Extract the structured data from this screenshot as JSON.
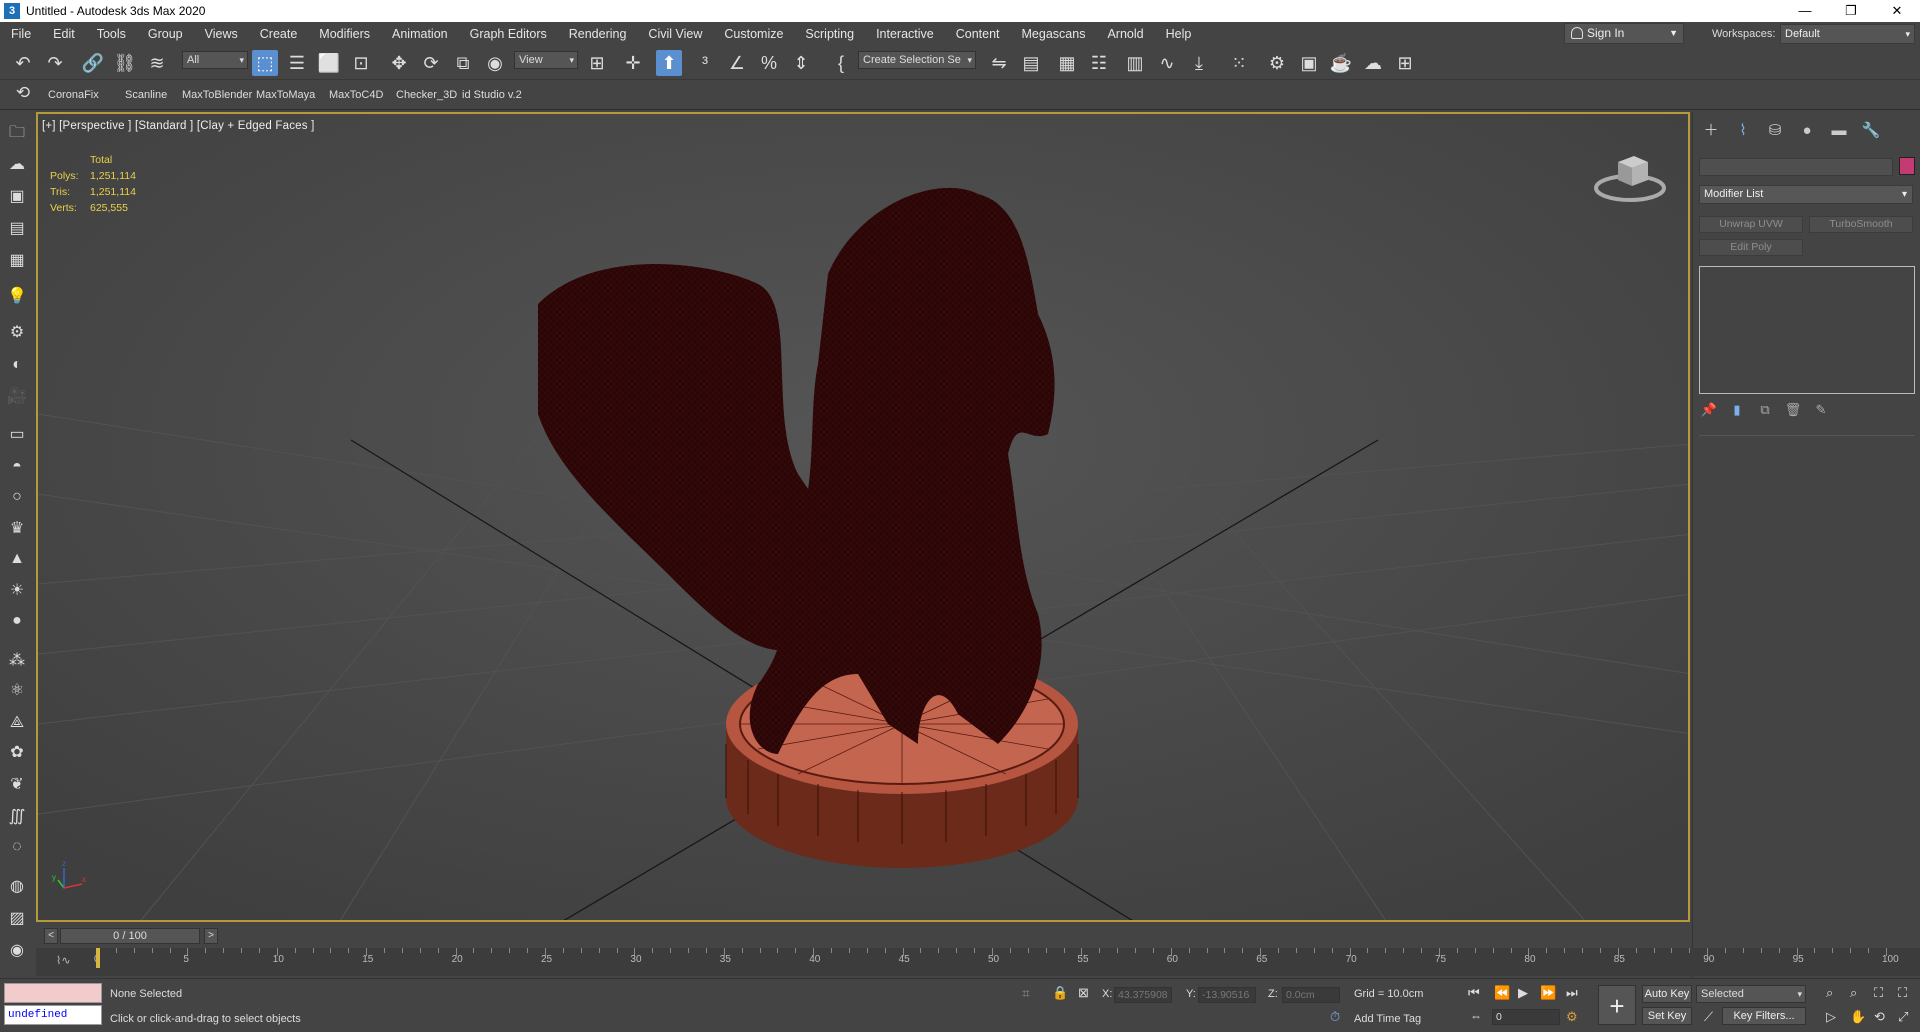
{
  "window": {
    "title": "Untitled - Autodesk 3ds Max 2020",
    "app_icon": "3"
  },
  "window_controls": {
    "minimize": "—",
    "maximize": "❐",
    "close": "✕"
  },
  "menu": [
    "File",
    "Edit",
    "Tools",
    "Group",
    "Views",
    "Create",
    "Modifiers",
    "Animation",
    "Graph Editors",
    "Rendering",
    "Civil View",
    "Customize",
    "Scripting",
    "Interactive",
    "Content",
    "Megascans",
    "Arnold",
    "Help"
  ],
  "account": {
    "sign_in": "Sign In",
    "workspaces_label": "Workspaces:",
    "workspace": "Default"
  },
  "main_toolbar": {
    "selection_filter": "All",
    "ref_coord": "View",
    "named_selection": "Create Selection Se"
  },
  "plugin_toolbar": {
    "items": [
      "CoronaFix",
      "Scanline",
      "MaxToBlender",
      "MaxToMaya",
      "MaxToC4D",
      "Checker_3D",
      "id Studio v.2"
    ]
  },
  "viewport": {
    "label": "[+] [Perspective ] [Standard ] [Clay + Edged Faces ]",
    "stats": {
      "header": "Total",
      "rows": [
        {
          "k": "Polys:",
          "v": "1,251,114"
        },
        {
          "k": "Tris:",
          "v": "1,251,114"
        },
        {
          "k": "Verts:",
          "v": "625,555"
        }
      ]
    },
    "axis": {
      "x": "x",
      "y": "y",
      "z": "z"
    }
  },
  "command_panel": {
    "modifier_list": "Modifier List",
    "buttons": [
      "Unwrap UVW",
      "TurboSmooth",
      "Edit Poly"
    ],
    "object_color": "#c43a72"
  },
  "time_slider": {
    "label": "0 / 100",
    "prev": "<",
    "next": ">"
  },
  "trackbar": {
    "ticks": [
      "0",
      "5",
      "10",
      "15",
      "20",
      "25",
      "30",
      "35",
      "40",
      "45",
      "50",
      "55",
      "60",
      "65",
      "70",
      "75",
      "80",
      "85",
      "90",
      "95",
      "100"
    ]
  },
  "status": {
    "maxscript_output": "undefined",
    "selection": "None Selected",
    "prompt": "Click or click-and-drag to select objects",
    "x_label": "X:",
    "x_value": "43.375908",
    "y_label": "Y:",
    "y_value": "-13.90516",
    "z_label": "Z:",
    "z_value": "0.0cm",
    "grid": "Grid = 10.0cm",
    "add_time_tag": "Add Time Tag",
    "auto_key": "Auto Key",
    "set_key": "Set Key",
    "key_mode": "Selected",
    "key_filters": "Key Filters...",
    "frame": "0"
  }
}
